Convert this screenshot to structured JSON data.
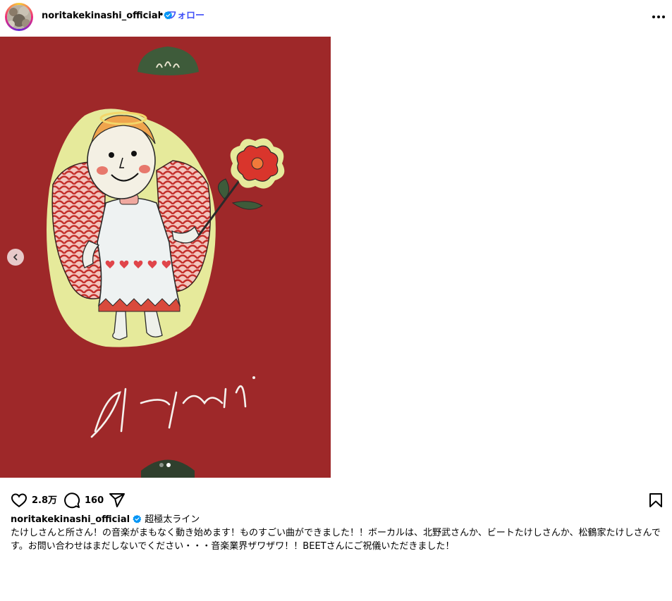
{
  "post": {
    "username": "noritakekinashi_official",
    "separator": "•",
    "follow_label": "フォロー"
  },
  "icons": {
    "verified": "verified-badge-icon",
    "more": "more-options-icon",
    "like": "heart-icon",
    "comment": "comment-icon",
    "share": "share-icon",
    "save": "bookmark-icon",
    "prev": "chevron-left-icon"
  },
  "carousel": {
    "total": 2,
    "current": 2
  },
  "actions": {
    "likes": "2.8万",
    "comments": "160"
  },
  "caption": {
    "username": "noritakekinashi_official",
    "headline": "超極太ライン",
    "body": "たけしさんと所さん！の音楽がまもなく動き始めます！ものすごい曲ができました！！ボーカルは、北野武さんか、ビートたけしさんか、松鶴家たけしさんです。お問い合わせはまだしないでください・・・音楽業界ザワザワ！！BEETさんにご祝儀いただきました！"
  },
  "colors": {
    "follow": "#4150f7",
    "verified": "#0095f6",
    "background_red": "#a32a2b",
    "pine_green": "#3e5b3a",
    "halo_yellow": "#e6ea9b"
  }
}
